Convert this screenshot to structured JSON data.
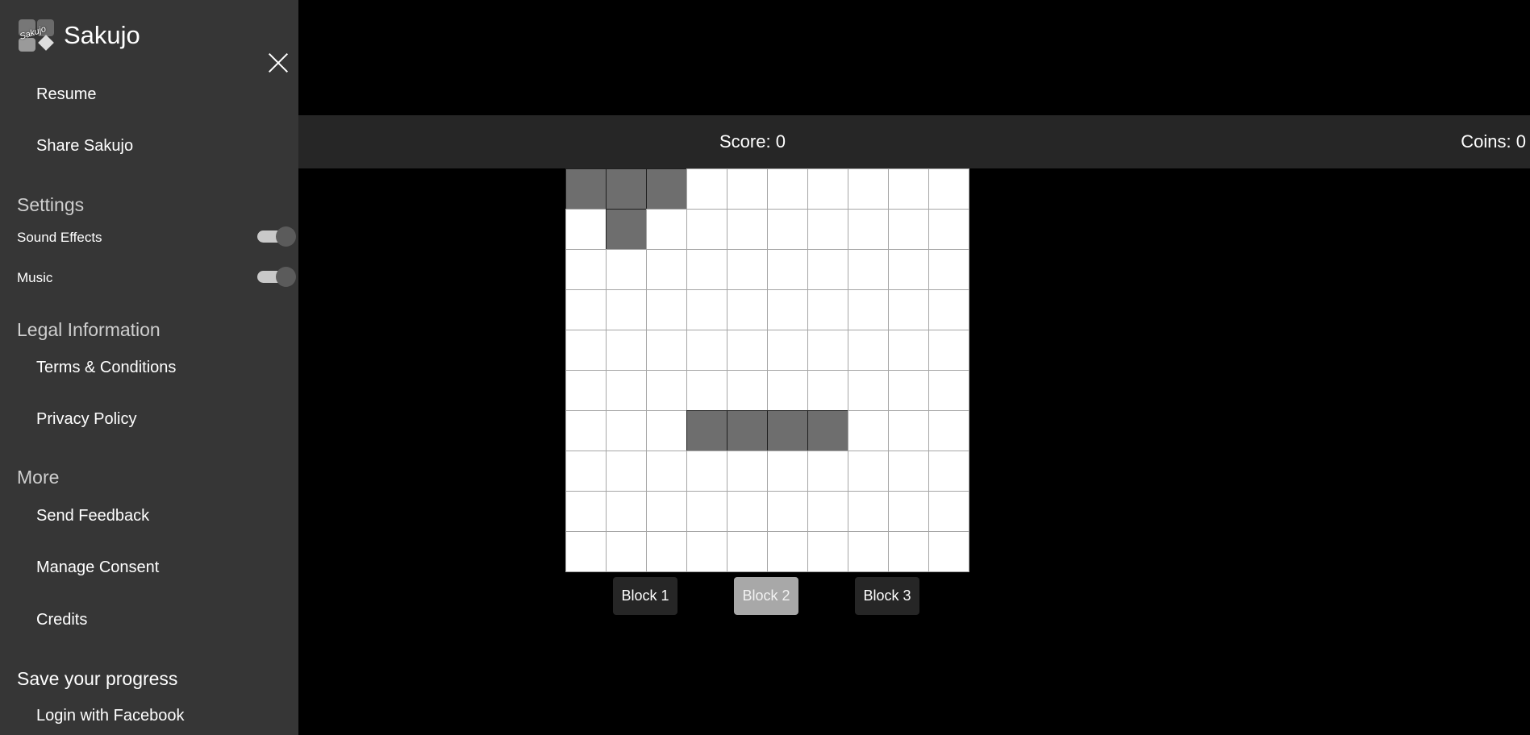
{
  "app": {
    "name": "Sakujo",
    "logo_text": "Sakujo"
  },
  "sidebar": {
    "top_items": [
      {
        "label": "Resume"
      },
      {
        "label": "Share Sakujo"
      }
    ],
    "settings": {
      "title": "Settings",
      "sound_effects": {
        "label": "Sound Effects",
        "on": true
      },
      "music": {
        "label": "Music",
        "on": true
      }
    },
    "legal": {
      "title": "Legal Information",
      "items": [
        {
          "label": "Terms & Conditions"
        },
        {
          "label": "Privacy Policy"
        }
      ]
    },
    "more": {
      "title": "More",
      "items": [
        {
          "label": "Send Feedback"
        },
        {
          "label": "Manage Consent"
        },
        {
          "label": "Credits"
        }
      ]
    },
    "progress": {
      "title": "Save your progress",
      "items": [
        {
          "label": "Login with Facebook"
        }
      ]
    }
  },
  "game": {
    "score_text": "Score: 0",
    "coins_text": "Coins: 0",
    "board": {
      "rows": 10,
      "cols": 10,
      "filled_cells": [
        [
          0,
          0
        ],
        [
          0,
          1
        ],
        [
          0,
          2
        ],
        [
          1,
          1
        ],
        [
          6,
          3
        ],
        [
          6,
          4
        ],
        [
          6,
          5
        ],
        [
          6,
          6
        ]
      ]
    },
    "blocks": [
      {
        "label": "Block 1",
        "active": false
      },
      {
        "label": "Block 2",
        "active": true
      },
      {
        "label": "Block 3",
        "active": false
      }
    ]
  },
  "colors": {
    "sidebar_bg": "#363636",
    "header_bg": "#262626",
    "filled_cell": "#6e6e6e",
    "active_block": "#a8a8a8"
  }
}
